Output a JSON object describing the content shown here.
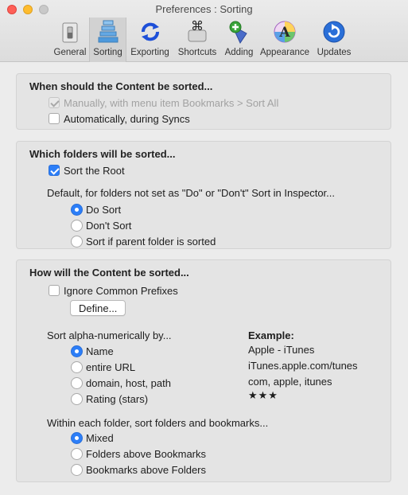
{
  "window": {
    "title": "Preferences : Sorting"
  },
  "toolbar": {
    "tabs": [
      {
        "label": "General",
        "icon": "switch-icon"
      },
      {
        "label": "Sorting",
        "icon": "sort-icon",
        "selected": true
      },
      {
        "label": "Exporting",
        "icon": "sync-arrows-icon"
      },
      {
        "label": "Shortcuts",
        "icon": "command-key-icon"
      },
      {
        "label": "Adding",
        "icon": "add-bookmark-icon"
      },
      {
        "label": "Appearance",
        "icon": "appearance-icon"
      },
      {
        "label": "Updates",
        "icon": "update-icon"
      }
    ]
  },
  "when_section": {
    "heading": "When should the Content be sorted...",
    "manually_label": "Manually, with menu item Bookmarks > Sort All",
    "manually_checked": true,
    "manually_disabled": true,
    "auto_label": "Automatically, during Syncs",
    "auto_checked": false
  },
  "which_section": {
    "heading": "Which folders will be sorted...",
    "sort_root_label": "Sort the Root",
    "sort_root_checked": true,
    "default_text": "Default, for folders not set as \"Do\" or \"Don't\" Sort in Inspector...",
    "options": [
      {
        "label": "Do Sort",
        "selected": true
      },
      {
        "label": "Don't Sort",
        "selected": false
      },
      {
        "label": "Sort if parent folder is sorted",
        "selected": false
      }
    ]
  },
  "how_section": {
    "heading": "How will the Content be sorted...",
    "ignore_prefixes_label": "Ignore Common Prefixes",
    "ignore_prefixes_checked": false,
    "define_button": "Define...",
    "alpha_label": "Sort alpha-numerically by...",
    "example_label": "Example:",
    "alpha_options": [
      {
        "label": "Name",
        "example": "Apple - iTunes",
        "selected": true
      },
      {
        "label": "entire URL",
        "example": "iTunes.apple.com/tunes",
        "selected": false
      },
      {
        "label": "domain, host, path",
        "example": "com, apple, itunes",
        "selected": false
      },
      {
        "label": "Rating (stars)",
        "example": "★★★",
        "selected": false
      }
    ],
    "within_label": "Within each folder, sort folders and bookmarks...",
    "within_options": [
      {
        "label": "Mixed",
        "selected": true
      },
      {
        "label": "Folders above Bookmarks",
        "selected": false
      },
      {
        "label": "Bookmarks above Folders",
        "selected": false
      }
    ]
  },
  "colors": {
    "accent": "#2c7ef8",
    "background": "#ececec",
    "group": "#e4e4e4"
  }
}
